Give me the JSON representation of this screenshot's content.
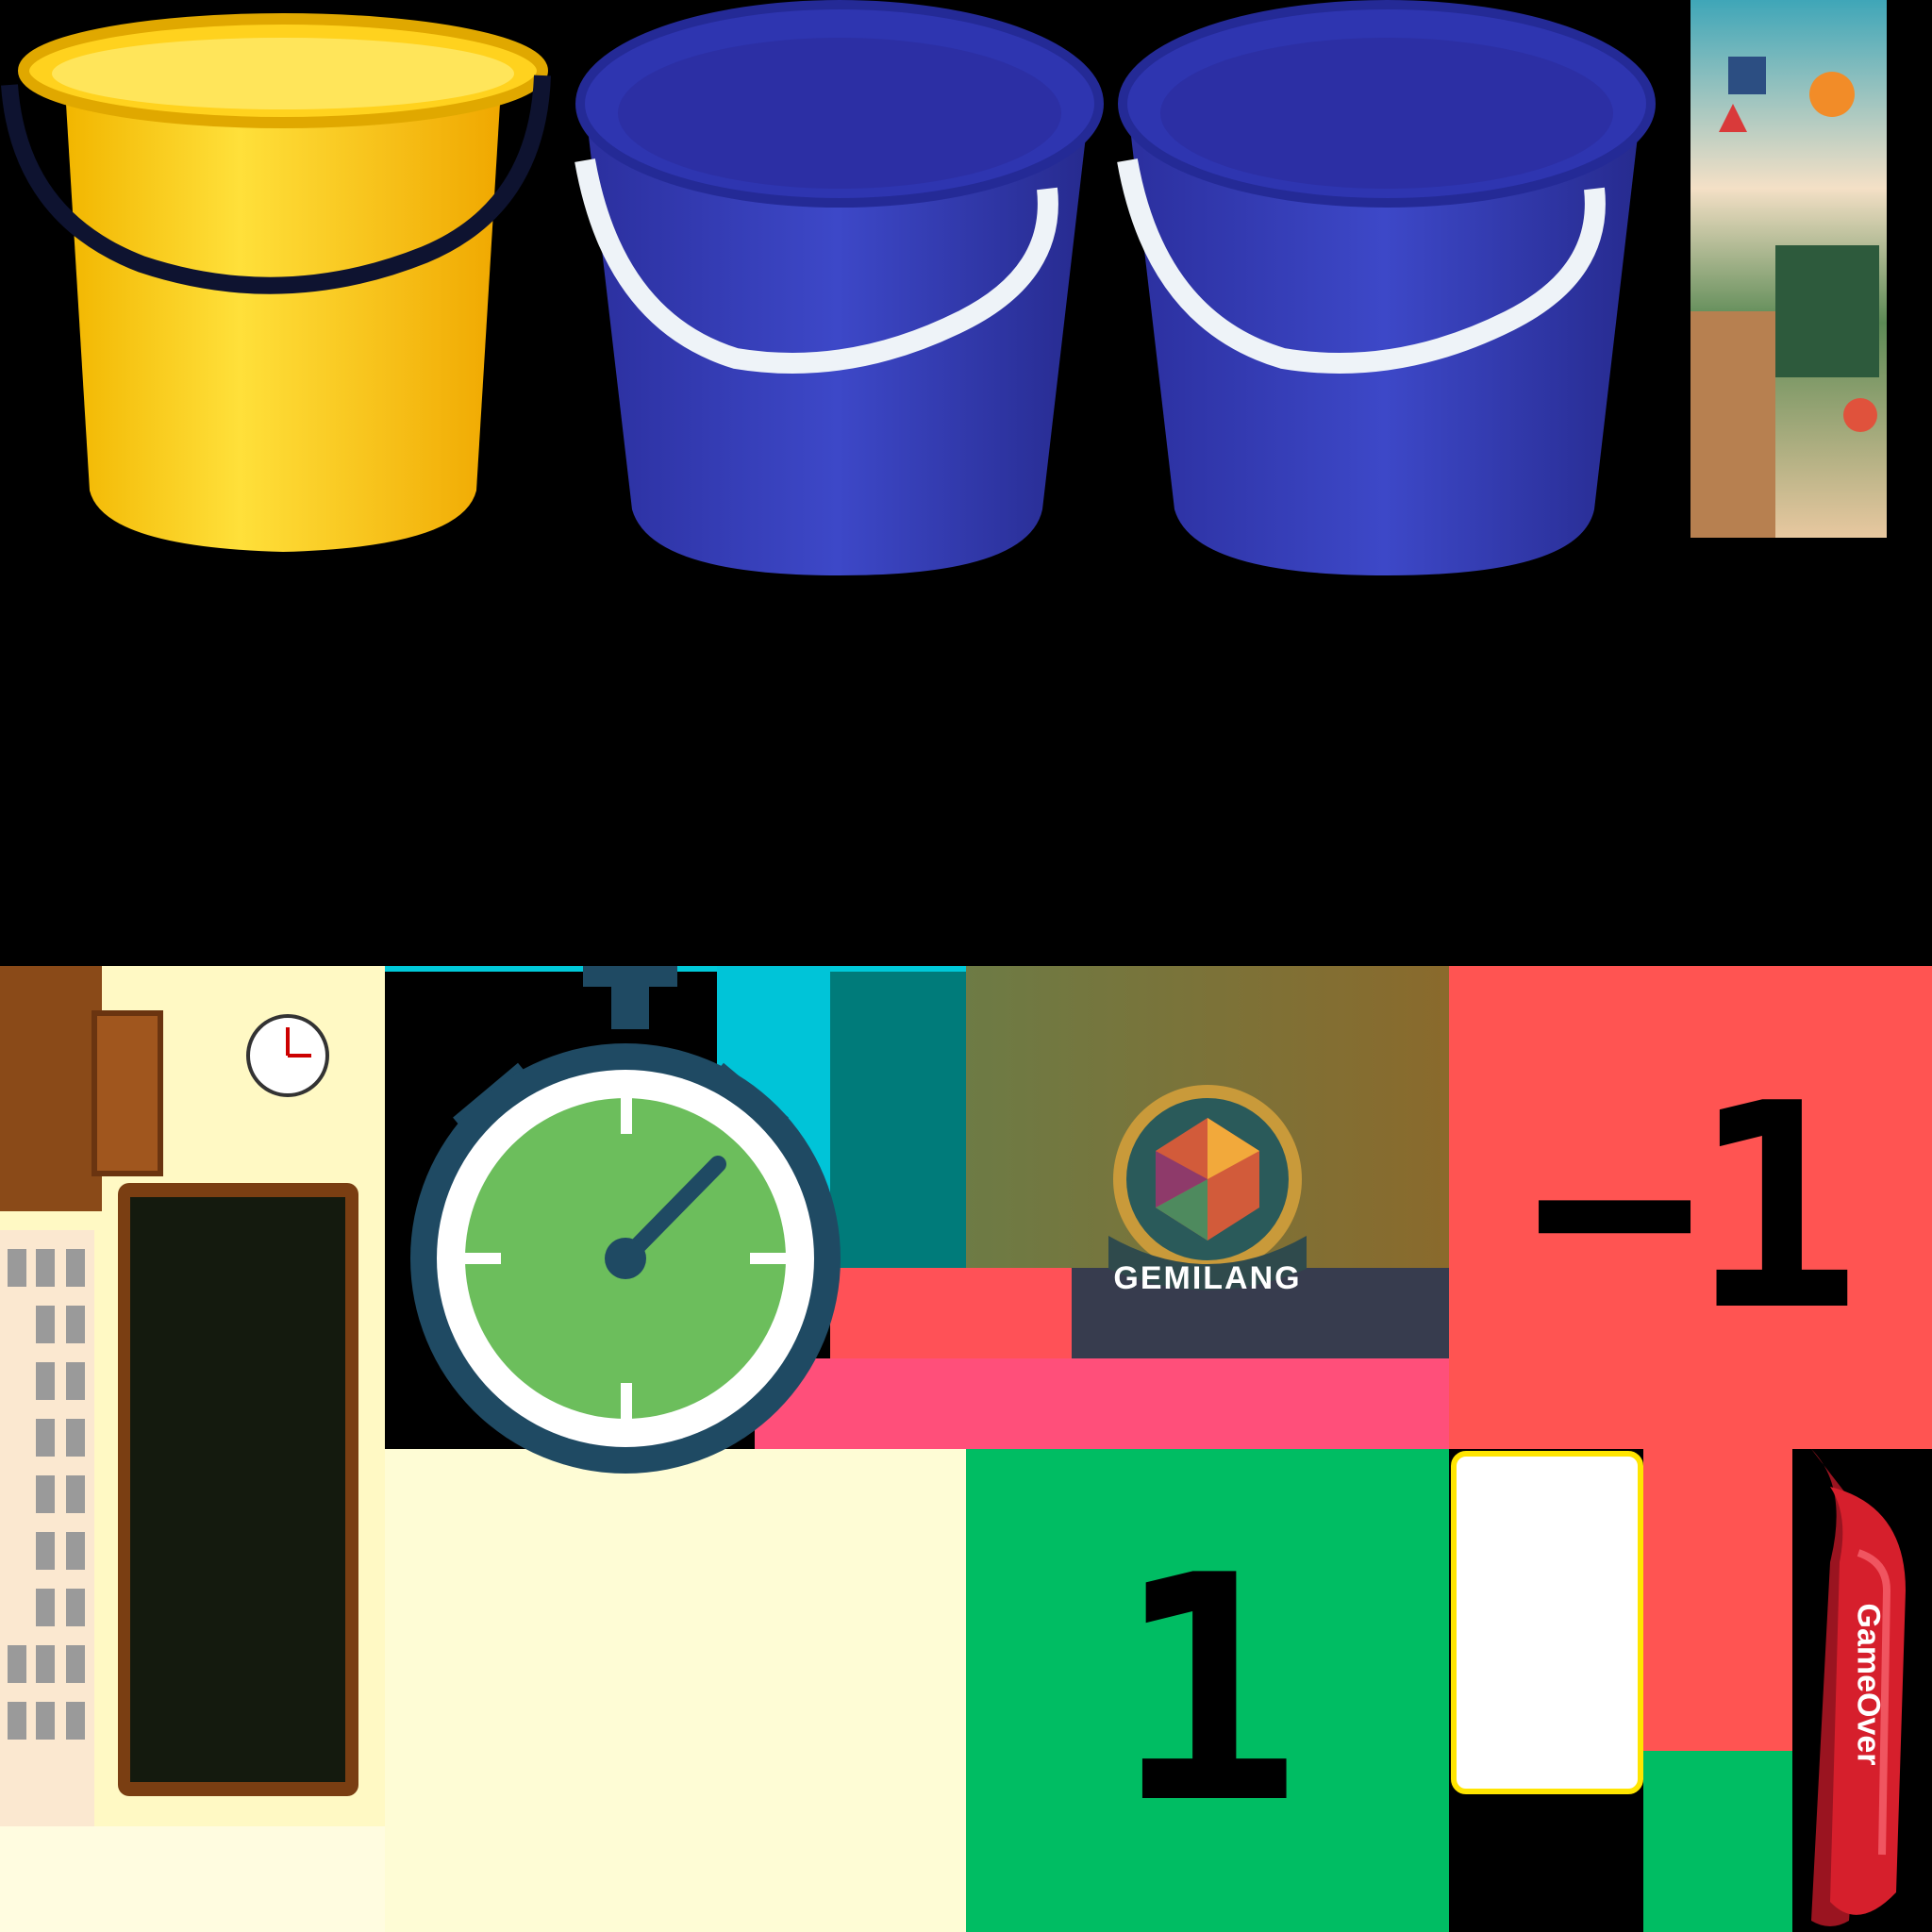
{
  "assets": {
    "yellow_bucket": "yellow-bucket-sprite",
    "blue_bucket": "blue-bucket-sprite",
    "poster": "math-classroom-background",
    "classroom": "classroom-scene-sprite",
    "stopwatch": "stopwatch-icon"
  },
  "logo": {
    "text": "GEMILANG"
  },
  "cards": {
    "minus_value": "−1",
    "plus_value": "1"
  },
  "banner": {
    "text": "GameOver"
  },
  "colors": {
    "yellow": "#FFC107",
    "blue": "#2E38A8",
    "red_card": "#FF5452",
    "green_card": "#00BD63",
    "stopwatch_face": "#6CBE5C",
    "stopwatch_frame": "#1F4A63",
    "banner_red": "#D61F2C"
  }
}
